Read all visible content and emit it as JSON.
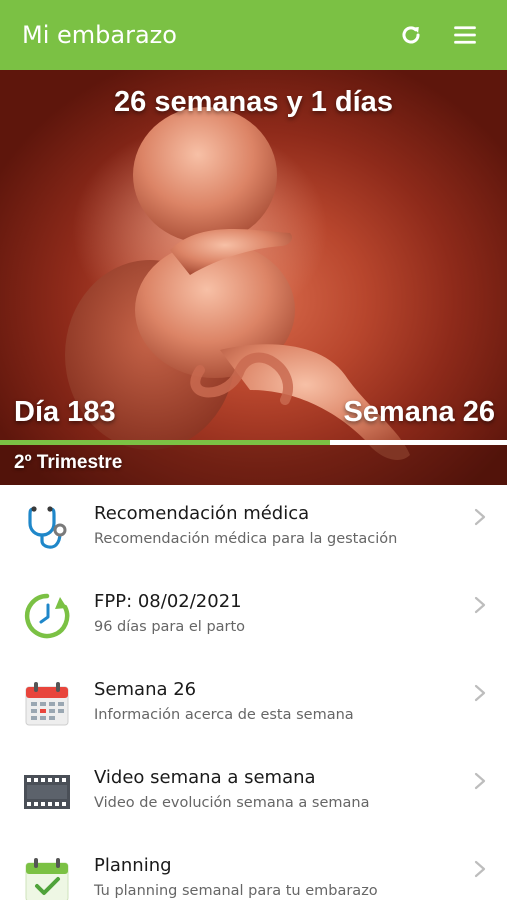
{
  "appbar": {
    "title": "Mi embarazo",
    "refresh_icon": "refresh-icon",
    "menu_icon": "hamburger-menu-icon"
  },
  "hero": {
    "weeks_days": "26 semanas y 1 días",
    "day_label": "Día 183",
    "week_label": "Semana 26",
    "trimester": "2º Trimestre",
    "progress_fraction": 0.65
  },
  "menu_items": [
    {
      "icon": "stethoscope-icon",
      "title": "Recomendación médica",
      "subtitle": "Recomendación médica para la gestación"
    },
    {
      "icon": "clock-countdown-icon",
      "title": "FPP: 08/02/2021",
      "subtitle": "96 días para el parto"
    },
    {
      "icon": "calendar-icon",
      "title": "Semana 26",
      "subtitle": "Información acerca de esta semana"
    },
    {
      "icon": "film-strip-icon",
      "title": "Video semana a semana",
      "subtitle": "Video de evolución semana a semana"
    },
    {
      "icon": "calendar-check-icon",
      "title": "Planning",
      "subtitle": "Tu planning semanal para tu embarazo"
    }
  ],
  "colors": {
    "accent_green": "#7bc144",
    "text_primary": "#1a1a1a",
    "text_secondary": "#666666",
    "chevron": "#bdbdbd"
  }
}
